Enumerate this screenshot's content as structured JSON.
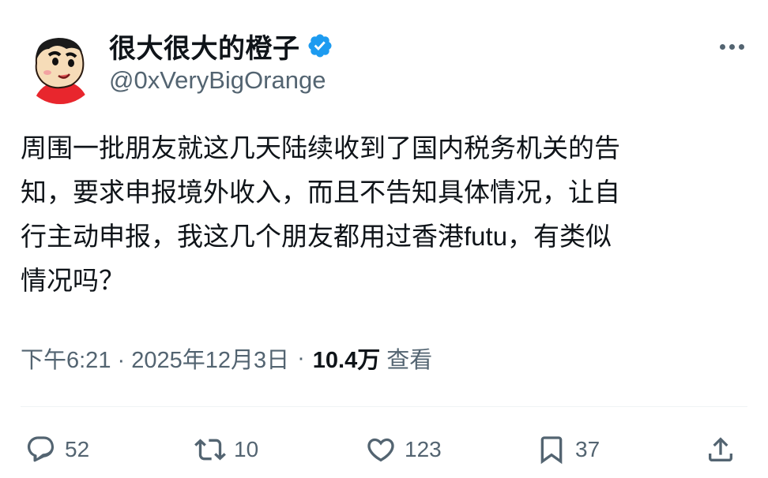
{
  "author": {
    "display_name": "很大很大的橙子",
    "handle": "@0xVeryBigOrange",
    "verified": true
  },
  "tweet": {
    "text": "周围一批朋友就这几天陆续收到了国内税务机关的告\n知，要求申报境外收入，而且不告知具体情况，让自\n行主动申报，我这几个朋友都用过香港futu，有类似\n情况吗？",
    "timestamp": "下午6:21 · 2025年12月3日",
    "separator": "·",
    "views_count": "10.4万",
    "views_label": "查看"
  },
  "actions": {
    "reply": {
      "icon": "reply-icon",
      "count": "52"
    },
    "retweet": {
      "icon": "retweet-icon",
      "count": "10"
    },
    "like": {
      "icon": "heart-icon",
      "count": "123"
    },
    "bookmark": {
      "icon": "bookmark-icon",
      "count": "37"
    },
    "share": {
      "icon": "share-icon"
    }
  },
  "colors": {
    "text_primary": "#0f1419",
    "text_secondary": "#536471",
    "verified_blue": "#1d9bf0",
    "divider": "#eff3f4"
  }
}
